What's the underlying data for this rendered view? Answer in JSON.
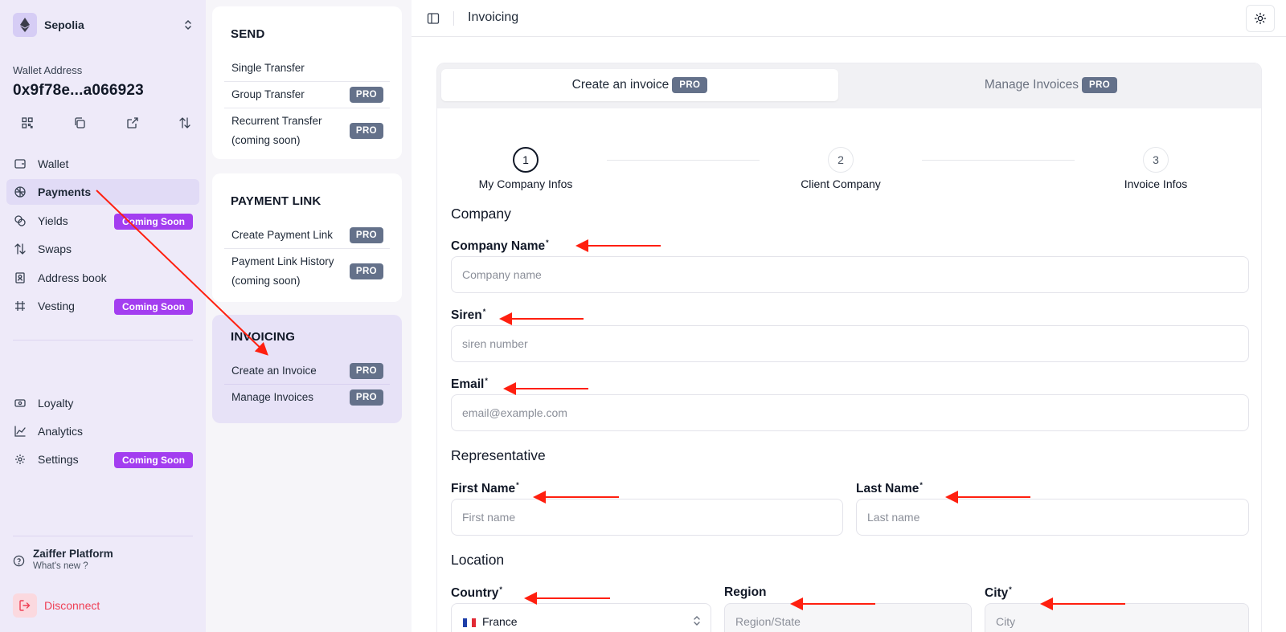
{
  "sidebar": {
    "network": {
      "name": "Sepolia",
      "icon": "ethereum-icon"
    },
    "wallet": {
      "label": "Wallet Address",
      "address": "0x9f78e...a066923"
    },
    "actions": [
      {
        "name": "qr-code-icon"
      },
      {
        "name": "copy-icon"
      },
      {
        "name": "external-link-icon"
      },
      {
        "name": "swap-arrows-icon"
      }
    ],
    "nav": [
      {
        "label": "Wallet",
        "icon": "wallet-icon"
      },
      {
        "label": "Payments",
        "icon": "payments-icon",
        "active": true
      },
      {
        "label": "Yields",
        "icon": "yields-icon",
        "badge": "Coming Soon"
      },
      {
        "label": "Swaps",
        "icon": "swaps-icon"
      },
      {
        "label": "Address book",
        "icon": "address-book-icon"
      },
      {
        "label": "Vesting",
        "icon": "vesting-icon",
        "badge": "Coming Soon"
      },
      {
        "label": "Loyalty",
        "icon": "loyalty-icon"
      },
      {
        "label": "Analytics",
        "icon": "analytics-icon"
      },
      {
        "label": "Settings",
        "icon": "settings-icon",
        "badge": "Coming Soon"
      }
    ],
    "help": {
      "title": "Zaiffer Platform",
      "subtitle": "What's new ?"
    },
    "disconnect": "Disconnect"
  },
  "menu": {
    "send": {
      "title": "SEND",
      "items": [
        {
          "label": "Single Transfer"
        },
        {
          "label": "Group Transfer",
          "badge": "PRO"
        },
        {
          "label": "Recurrent Transfer (coming soon)",
          "badge": "PRO"
        }
      ]
    },
    "payment_link": {
      "title": "PAYMENT LINK",
      "items": [
        {
          "label": "Create Payment Link",
          "badge": "PRO"
        },
        {
          "label": "Payment Link History (coming soon)",
          "badge": "PRO"
        }
      ]
    },
    "invoicing": {
      "title": "INVOICING",
      "items": [
        {
          "label": "Create an Invoice",
          "badge": "PRO"
        },
        {
          "label": "Manage Invoices",
          "badge": "PRO"
        }
      ]
    }
  },
  "topbar": {
    "title": "Invoicing"
  },
  "tabs": [
    {
      "label": "Create an invoice",
      "badge": "PRO",
      "active": true
    },
    {
      "label": "Manage Invoices",
      "badge": "PRO",
      "active": false
    }
  ],
  "steps": [
    {
      "number": "1",
      "label": "My Company Infos",
      "active": true
    },
    {
      "number": "2",
      "label": "Client Company"
    },
    {
      "number": "3",
      "label": "Invoice Infos"
    }
  ],
  "form": {
    "company": {
      "title": "Company",
      "name": {
        "label": "Company Name",
        "required": "*",
        "placeholder": "Company name"
      },
      "siren": {
        "label": "Siren",
        "required": "*",
        "placeholder": "siren number"
      },
      "email": {
        "label": "Email",
        "required": "*",
        "placeholder": "email@example.com"
      }
    },
    "representative": {
      "title": "Representative",
      "first_name": {
        "label": "First Name",
        "required": "*",
        "placeholder": "First name"
      },
      "last_name": {
        "label": "Last Name",
        "required": "*",
        "placeholder": "Last name"
      }
    },
    "location": {
      "title": "Location",
      "country": {
        "label": "Country",
        "required": "*",
        "value": "France"
      },
      "region": {
        "label": "Region",
        "placeholder": "Region/State"
      },
      "city": {
        "label": "City",
        "required": "*",
        "placeholder": "City"
      }
    }
  },
  "colors": {
    "accent_purple": "#a33ef0",
    "pro_badge": "#64718a",
    "sidebar_bg": "#eeeaf9",
    "annotation_red": "#ff1f0f"
  }
}
